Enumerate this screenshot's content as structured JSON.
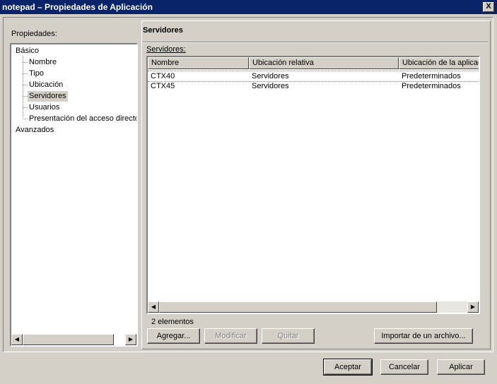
{
  "window": {
    "title": "notepad – Propiedades de Aplicación",
    "close_label": "X"
  },
  "properties_label": "Propiedades:",
  "tree": {
    "root_basic": "Básico",
    "children": [
      "Nombre",
      "Tipo",
      "Ubicación",
      "Servidores",
      "Usuarios",
      "Presentación del acceso directo"
    ],
    "selected": "Servidores",
    "root_advanced": "Avanzados"
  },
  "section_title": "Servidores",
  "servers_label": "Servidores:",
  "table": {
    "columns": [
      "Nombre",
      "Ubicación relativa",
      "Ubicación de la aplicación"
    ],
    "rows": [
      [
        "CTX40",
        "Servidores",
        "Predeterminados"
      ],
      [
        "CTX45",
        "Servidores",
        "Predeterminados"
      ]
    ]
  },
  "count_label": "2 elementos",
  "actions": {
    "add": "Agregar...",
    "modify": "Modificar",
    "remove": "Quitar",
    "import": "Importar de un archivo..."
  },
  "footer": {
    "ok": "Aceptar",
    "cancel": "Cancelar",
    "apply": "Aplicar"
  }
}
